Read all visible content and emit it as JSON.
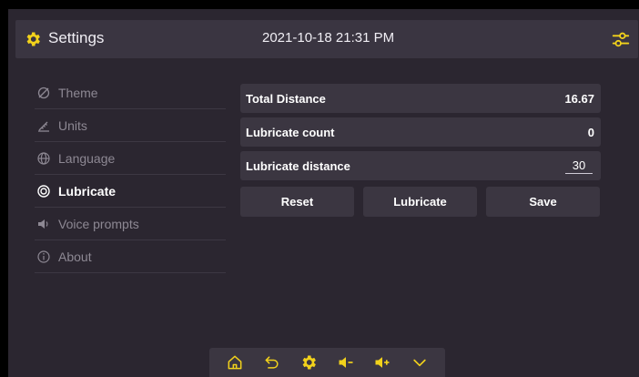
{
  "header": {
    "title": "Settings",
    "datetime": "2021-10-18 21:31 PM",
    "icons": [
      "settings-gear-icon",
      "tune-sliders-icon"
    ]
  },
  "accent_color": "#f2d21b",
  "menu": [
    {
      "label": "Theme",
      "icon": "theme-icon",
      "active": false
    },
    {
      "label": "Units",
      "icon": "units-icon",
      "active": false
    },
    {
      "label": "Language",
      "icon": "globe-icon",
      "active": false
    },
    {
      "label": "Lubricate",
      "icon": "target-icon",
      "active": true
    },
    {
      "label": "Voice prompts",
      "icon": "speaker-icon",
      "active": false
    },
    {
      "label": "About",
      "icon": "info-icon",
      "active": false
    }
  ],
  "panel": {
    "total_distance_label": "Total Distance",
    "total_distance_value": "16.67",
    "lubricate_count_label": "Lubricate count",
    "lubricate_count_value": "0",
    "lubricate_distance_label": "Lubricate distance",
    "lubricate_distance_value": "30"
  },
  "buttons": {
    "reset": "Reset",
    "lubricate": "Lubricate",
    "save": "Save"
  },
  "dock": [
    "home-icon",
    "back-icon",
    "settings-icon",
    "volume-down-icon",
    "volume-up-icon",
    "chevron-down-icon"
  ]
}
